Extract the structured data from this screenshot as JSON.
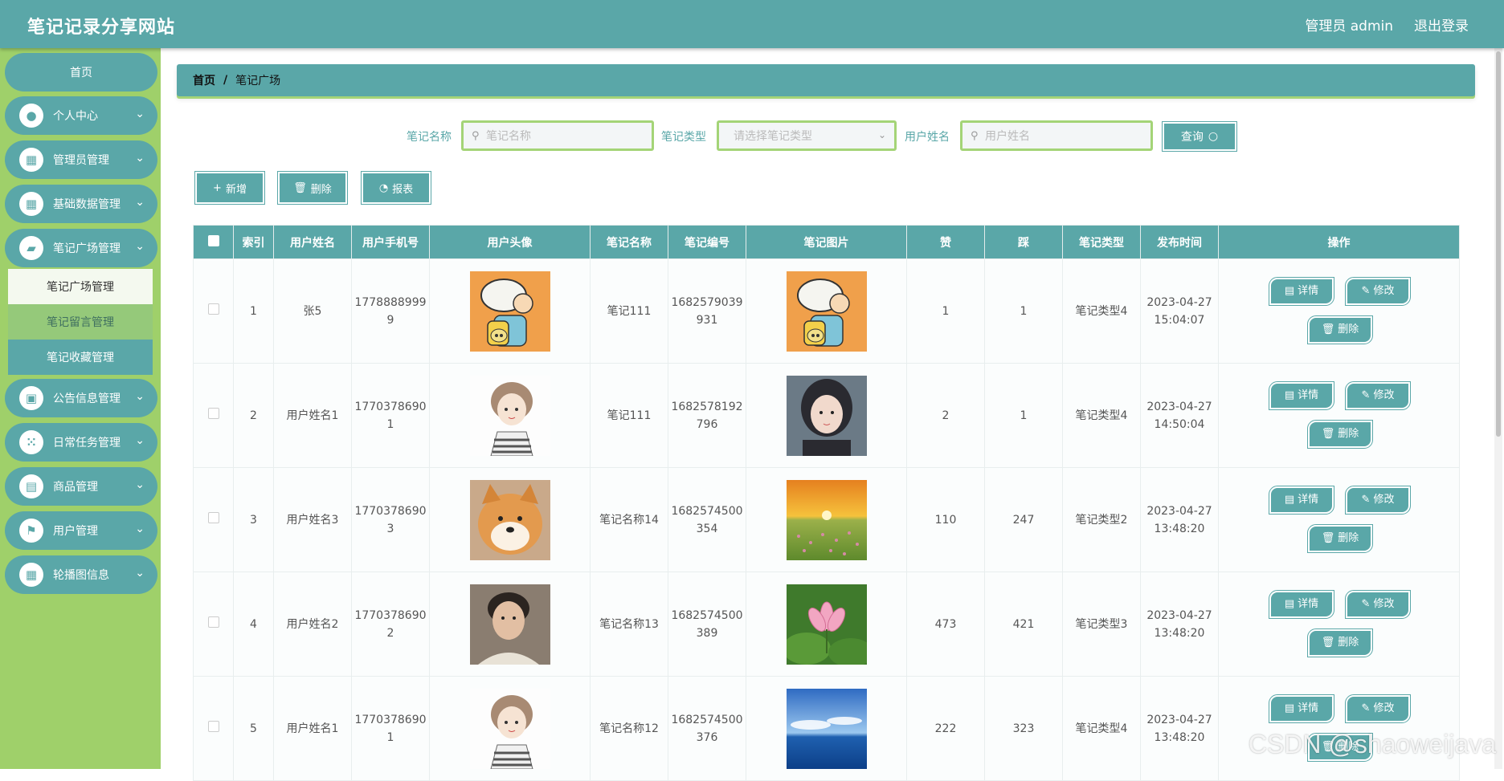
{
  "header": {
    "site_title": "笔记记录分享网站",
    "user": "管理员 admin",
    "logout": "退出登录"
  },
  "sidebar": {
    "home": "首页",
    "items": [
      {
        "label": "个人中心",
        "icon": "user-icon"
      },
      {
        "label": "管理员管理",
        "icon": "grid-icon"
      },
      {
        "label": "基础数据管理",
        "icon": "grid-icon"
      },
      {
        "label": "笔记广场管理",
        "icon": "folder-icon"
      },
      {
        "label": "公告信息管理",
        "icon": "briefcase-icon"
      },
      {
        "label": "日常任务管理",
        "icon": "apps-icon"
      },
      {
        "label": "商品管理",
        "icon": "clipboard-icon"
      },
      {
        "label": "用户管理",
        "icon": "flag-icon"
      },
      {
        "label": "轮播图信息",
        "icon": "grid-icon"
      }
    ],
    "submenu": [
      "笔记广场管理",
      "笔记留言管理",
      "笔记收藏管理"
    ]
  },
  "breadcrumb": {
    "home": "首页",
    "sep": "/",
    "current": "笔记广场"
  },
  "search": {
    "name_label": "笔记名称",
    "name_placeholder": "笔记名称",
    "type_label": "笔记类型",
    "type_placeholder": "请选择笔记类型",
    "user_label": "用户姓名",
    "user_placeholder": "用户姓名",
    "query": "查询"
  },
  "actions": {
    "add": "新增",
    "delete": "删除",
    "report": "报表"
  },
  "table": {
    "columns": [
      "",
      "索引",
      "用户姓名",
      "用户手机号",
      "用户头像",
      "笔记名称",
      "笔记编号",
      "笔记图片",
      "赞",
      "踩",
      "笔记类型",
      "发布时间",
      "操作"
    ],
    "rows": [
      {
        "index": "1",
        "name": "张5",
        "phone": "17788889999",
        "avatar": "cartoon-boy",
        "note_name": "笔记111",
        "note_no": "1682579039931",
        "image": "cartoon-boy",
        "like": "1",
        "dislike": "1",
        "type": "笔记类型4",
        "time": "2023-04-27 15:04:07"
      },
      {
        "index": "2",
        "name": "用户姓名1",
        "phone": "17703786901",
        "avatar": "cartoon-girl",
        "note_name": "笔记111",
        "note_no": "1682578192796",
        "image": "portrait-girl",
        "like": "2",
        "dislike": "1",
        "type": "笔记类型4",
        "time": "2023-04-27 14:50:04"
      },
      {
        "index": "3",
        "name": "用户姓名3",
        "phone": "17703786903",
        "avatar": "shiba-dog",
        "note_name": "笔记名称14",
        "note_no": "1682574500354",
        "image": "sunset-field",
        "like": "110",
        "dislike": "247",
        "type": "笔记类型2",
        "time": "2023-04-27 13:48:20"
      },
      {
        "index": "4",
        "name": "用户姓名2",
        "phone": "17703786902",
        "avatar": "young-man",
        "note_name": "笔记名称13",
        "note_no": "1682574500389",
        "image": "lotus",
        "like": "473",
        "dislike": "421",
        "type": "笔记类型3",
        "time": "2023-04-27 13:48:20"
      },
      {
        "index": "5",
        "name": "用户姓名1",
        "phone": "17703786901",
        "avatar": "cartoon-girl",
        "note_name": "笔记名称12",
        "note_no": "1682574500376",
        "image": "sea-sky",
        "like": "222",
        "dislike": "323",
        "type": "笔记类型4",
        "time": "2023-04-27 13:48:20"
      }
    ],
    "op_detail": "详情",
    "op_edit": "修改",
    "op_delete": "删除"
  },
  "watermark": "CSDN @shaoweijava",
  "colors": {
    "primary": "#5aa7a8",
    "sidebar": "#9fd06a",
    "accent": "#a4d477"
  }
}
